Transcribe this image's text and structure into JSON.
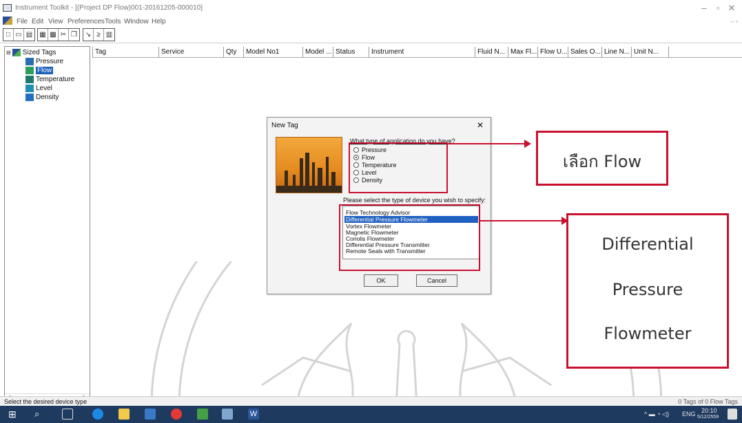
{
  "window": {
    "title": "Instrument Toolkit - [(Project DP Flow)001-20161205-000010]",
    "minimize": "–",
    "restore": "▫",
    "close": "✕",
    "mdi_controls": "– ▫"
  },
  "menu": [
    "File",
    "Edit",
    "View",
    "Preferences",
    "Tools",
    "Window",
    "Help"
  ],
  "tree": {
    "root": "Sized Tags",
    "items": [
      "Pressure",
      "Flow",
      "Temperature",
      "Level",
      "Density"
    ],
    "selected": "Flow"
  },
  "grid": {
    "columns": [
      "Tag",
      "Service",
      "Qty",
      "Model No1",
      "Model ...",
      "Status",
      "Instrument",
      "Fluid N...",
      "Max Fl...",
      "Flow U...",
      "Sales O...",
      "Line N...",
      "Unit N..."
    ]
  },
  "dialog": {
    "title": "New Tag",
    "close": "✕",
    "question": "What type of application do you have?",
    "options": [
      "Pressure",
      "Flow",
      "Temperature",
      "Level",
      "Density"
    ],
    "selected_option": "Flow",
    "prompt": "Please select the type of device you wish to specify:",
    "devices": [
      "Flow Technology Advisor",
      "Differential Pressure Flowmeter",
      "Vortex Flowmeter",
      "Magnetic Flowmeter",
      "Coriolis Flowmeter",
      "Differential Pressure Transmitter",
      "Remote Seals with Transmitter"
    ],
    "selected_device": "Differential Pressure Flowmeter",
    "ok_label": "OK",
    "cancel_label": "Cancel"
  },
  "annotations": {
    "callout1": "เลือก Flow",
    "callout2_lines": [
      "Differential",
      "Pressure",
      "Flowmeter"
    ],
    "color": "#c8102e"
  },
  "status": {
    "left": "Select the desired device type",
    "right": "0 Tags of 0 Flow Tags"
  },
  "taskbar": {
    "lang": "ENG",
    "time": "20:10",
    "date": "5/12/2559"
  }
}
